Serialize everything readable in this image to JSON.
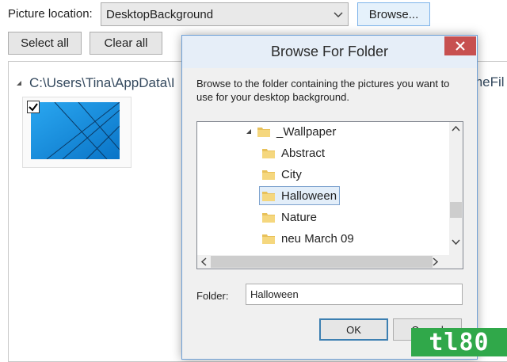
{
  "background_window": {
    "picture_location_label": "Picture location:",
    "picture_location_value": "DesktopBackground",
    "browse_button": "Browse...",
    "select_all_button": "Select all",
    "clear_all_button": "Clear all",
    "path_left": "C:\\Users\\Tina\\AppData\\I",
    "path_right": "meFil"
  },
  "dialog": {
    "title": "Browse For Folder",
    "instructions": "Browse to the folder containing the pictures you want to use for your desktop background.",
    "tree": {
      "parent": "_Wallpaper",
      "children": [
        "Abstract",
        "City",
        "Halloween",
        "Nature",
        "neu March 09"
      ],
      "selected": "Halloween"
    },
    "folder_label": "Folder:",
    "folder_value": "Halloween",
    "ok_button": "OK",
    "cancel_button": "Cancel"
  },
  "logo_text": "tl80",
  "colors": {
    "close_red": "#c75050",
    "title_bar": "#e6eef8",
    "selection_blue": "#e3eef9",
    "logo_green": "#30a84a"
  }
}
